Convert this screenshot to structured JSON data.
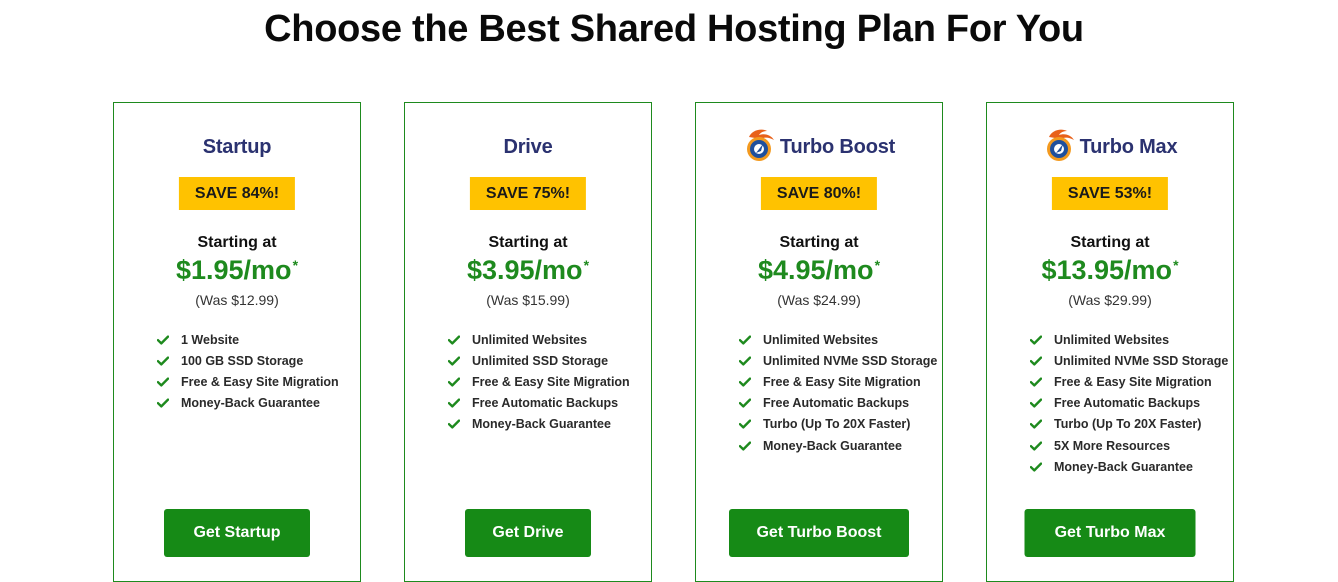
{
  "page": {
    "title": "Choose the Best Shared Hosting Plan For You"
  },
  "colors": {
    "accent_green": "#168a16",
    "card_border": "#1e8a1e",
    "badge_yellow": "#ffc200",
    "plan_name_navy": "#2b3270"
  },
  "plans": [
    {
      "name": "Startup",
      "has_turbo_icon": false,
      "save_label": "SAVE 84%!",
      "starting_label": "Starting at",
      "price": "$1.95/mo",
      "price_mark": "*",
      "was_price": "(Was $12.99)",
      "features": [
        "1 Website",
        "100 GB SSD Storage",
        "Free & Easy Site Migration",
        "Money-Back Guarantee"
      ],
      "cta_label": "Get Startup",
      "feature_icon": "check-icon"
    },
    {
      "name": "Drive",
      "has_turbo_icon": false,
      "save_label": "SAVE 75%!",
      "starting_label": "Starting at",
      "price": "$3.95/mo",
      "price_mark": "*",
      "was_price": "(Was $15.99)",
      "features": [
        "Unlimited Websites",
        "Unlimited SSD Storage",
        "Free & Easy Site Migration",
        "Free Automatic Backups",
        "Money-Back Guarantee"
      ],
      "cta_label": "Get Drive",
      "feature_icon": "check-icon"
    },
    {
      "name": "Turbo Boost",
      "has_turbo_icon": true,
      "save_label": "SAVE 80%!",
      "starting_label": "Starting at",
      "price": "$4.95/mo",
      "price_mark": "*",
      "was_price": "(Was $24.99)",
      "features": [
        "Unlimited Websites",
        "Unlimited NVMe SSD Storage",
        "Free & Easy Site Migration",
        "Free Automatic Backups",
        "Turbo (Up To 20X Faster)",
        "Money-Back Guarantee"
      ],
      "cta_label": "Get Turbo Boost",
      "feature_icon": "check-icon"
    },
    {
      "name": "Turbo Max",
      "has_turbo_icon": true,
      "save_label": "SAVE 53%!",
      "starting_label": "Starting at",
      "price": "$13.95/mo",
      "price_mark": "*",
      "was_price": "(Was $29.99)",
      "features": [
        "Unlimited Websites",
        "Unlimited NVMe SSD Storage",
        "Free & Easy Site Migration",
        "Free Automatic Backups",
        "Turbo (Up To 20X Faster)",
        "5X More Resources",
        "Money-Back Guarantee"
      ],
      "cta_label": "Get Turbo Max",
      "feature_icon": "check-icon"
    }
  ]
}
